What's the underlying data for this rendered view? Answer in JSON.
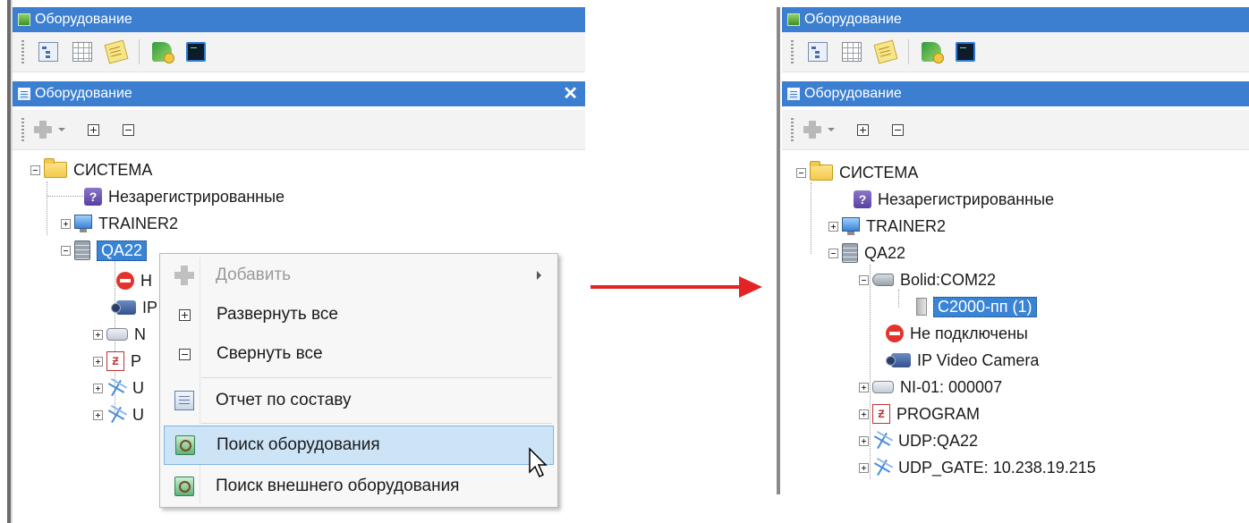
{
  "left": {
    "window_title": "Оборудование",
    "panel_title": "Оборудование",
    "close_glyph": "✕",
    "tree": {
      "root": "СИСТЕМА",
      "unregistered": "Незарегистрированные",
      "trainer": "TRAINER2",
      "qa": "QA22",
      "child_h": "H",
      "child_ip": "IP",
      "child_n": "N",
      "child_p": "P",
      "child_u1": "U",
      "child_u2": "U"
    },
    "context_menu": {
      "add": "Добавить",
      "expand_all": "Развернуть все",
      "collapse_all": "Свернуть все",
      "report": "Отчет по составу",
      "search_equipment": "Поиск оборудования",
      "search_external": "Поиск внешнего оборудования"
    }
  },
  "right": {
    "window_title": "Оборудование",
    "panel_title": "Оборудование",
    "tree": {
      "root": "СИСТЕМА",
      "unregistered": "Незарегистрированные",
      "trainer": "TRAINER2",
      "qa": "QA22",
      "bolid": "Bolid:COM22",
      "c2000": "С2000-пп (1)",
      "not_connected": "Не подключены",
      "ip_camera": "IP Video Camera",
      "ni": "NI-01: 000007",
      "program": "PROGRAM",
      "udp_qa": "UDP:QA22",
      "udp_gate": "UDP_GATE: 10.238.19.215"
    }
  },
  "icons": {
    "folder": "folder-icon",
    "unknown": "question-icon",
    "computer": "monitor-icon",
    "server": "server-icon",
    "not_connected": "no-entry-icon",
    "camera": "camera-icon",
    "drive": "drive-icon",
    "program": "program-icon",
    "network": "network-icon",
    "device": "device-icon"
  },
  "colors": {
    "title_bar": "#3c7fd0",
    "arrow": "#e32424",
    "selection": "#3a84d6",
    "menu_hover": "#cde4f7"
  }
}
